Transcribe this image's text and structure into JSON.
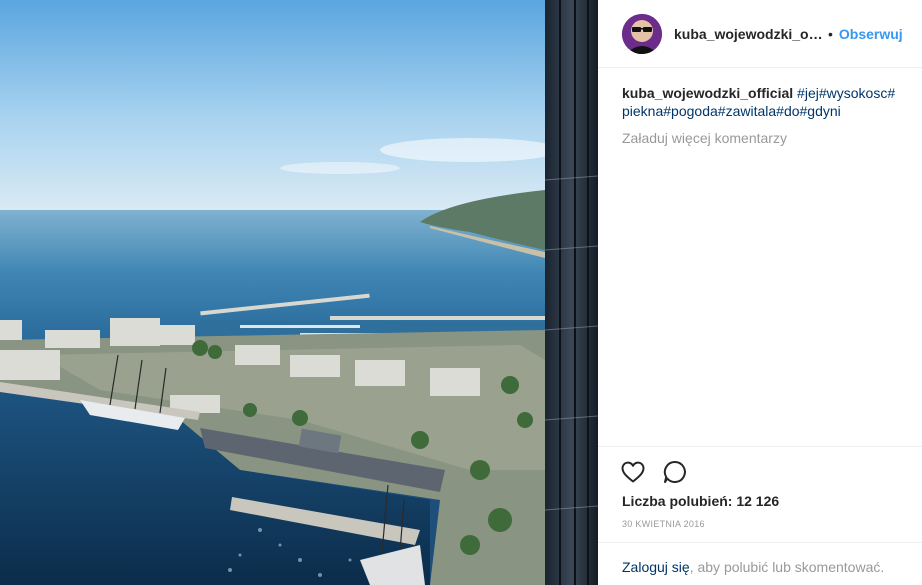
{
  "post": {
    "username": "kuba_wojewodzki_offi...",
    "dot": "•",
    "follow_label": "Obserwuj",
    "caption_author": "kuba_wojewodzki_official",
    "caption_tags": [
      "#jej",
      "#wysokosc",
      "#piekna",
      "#pogoda",
      "#zawitala",
      "#do",
      "#gdyni"
    ],
    "load_more_label": "Załaduj więcej komentarzy",
    "likes_text": "Liczba polubień: 12 126",
    "date": "30 KWIETNIA 2016",
    "login_link": "Zaloguj się",
    "login_rest": ", aby polubić lub skomentować.",
    "more_label": "..."
  },
  "icons": {
    "like": "heart-icon",
    "comment": "speech-bubble-icon",
    "avatar": "profile-photo"
  },
  "colors": {
    "link": "#003569",
    "follow": "#3897f0",
    "muted": "#999999",
    "text": "#262626",
    "border": "#efefef"
  },
  "photo": {
    "subject": "aerial view of Gdynia harbour and marina from a skyscraper"
  }
}
